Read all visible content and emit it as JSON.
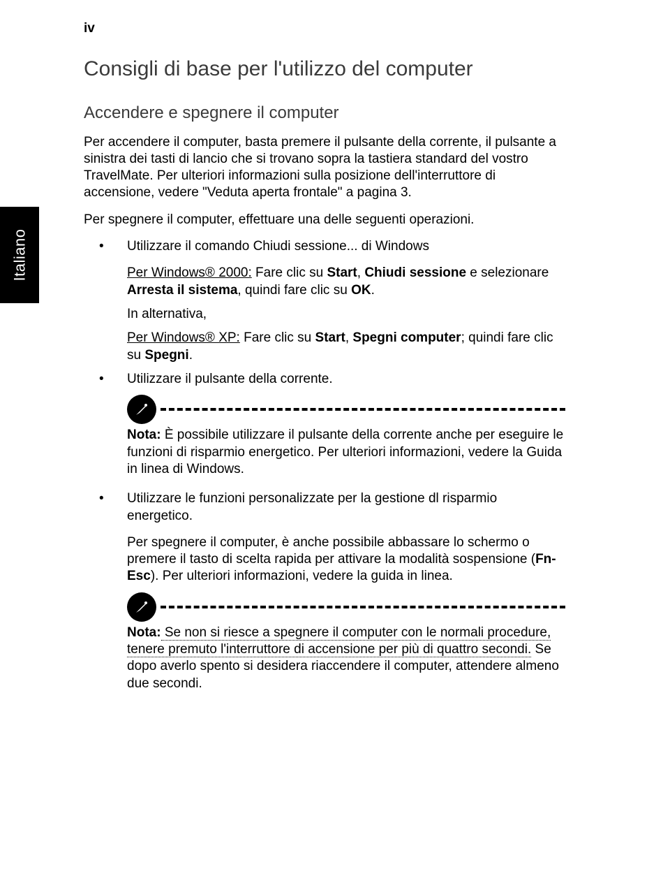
{
  "page_number": "iv",
  "sidebar_language": "Italiano",
  "title": "Consigli di base per l'utilizzo del computer",
  "subtitle": "Accendere e spegnere il computer",
  "intro_paragraph": "Per accendere il computer, basta premere il pulsante della corrente, il pulsante a sinistra dei tasti di lancio che si trovano sopra la tastiera standard del vostro TravelMate. Per ulteriori informazioni sulla posizione dell'interruttore di accensione, vedere \"Veduta aperta frontale\" a pagina 3.",
  "shutdown_intro": "Per spegnere il computer, effettuare una delle seguenti operazioni.",
  "bullet1_lead": "Utilizzare il comando Chiudi sessione... di Windows",
  "bullet1_win2000_prefix": "Per Windows® 2000:",
  "bullet1_win2000_body_1": " Fare clic su ",
  "bullet1_win2000_strong1": "Start",
  "bullet1_win2000_body_2": ", ",
  "bullet1_win2000_strong2": "Chiudi sessione",
  "bullet1_win2000_body_3": " e selezionare ",
  "bullet1_win2000_strong3": "Arresta il sistema",
  "bullet1_win2000_body_4": ", quindi fare clic su ",
  "bullet1_win2000_strong4": "OK",
  "bullet1_win2000_body_5": ".",
  "bullet1_alt": "In alternativa,",
  "bullet1_winxp_prefix": "Per Windows® XP:",
  "bullet1_winxp_body_1": " Fare clic su ",
  "bullet1_winxp_strong1": "Start",
  "bullet1_winxp_body_2": ", ",
  "bullet1_winxp_strong2": "Spegni computer",
  "bullet1_winxp_body_3": "; quindi fare clic su ",
  "bullet1_winxp_strong3": "Spegni",
  "bullet1_winxp_body_4": ".",
  "bullet2": "Utilizzare il pulsante della corrente.",
  "note1_label": "Nota:",
  "note1_text": " È possibile utilizzare il pulsante della corrente anche per eseguire le funzioni di risparmio energetico. Per ulteriori informazioni, vedere la Guida in linea di Windows.",
  "bullet3": "Utilizzare le funzioni personalizzate per la gestione dl risparmio energetico.",
  "bullet3_sub_1": "Per spegnere il computer, è anche possibile abbassare lo schermo o premere il tasto di scelta rapida per attivare la modalità sospensione (",
  "bullet3_sub_strong": "Fn-Esc",
  "bullet3_sub_2": "). Per ulteriori informazioni, vedere la guida in linea.",
  "note2_label": "Nota:",
  "note2_text_dotted": " Se non si riesce a spegnere il computer con le normali procedure, tenere premuto l'interruttore di accensione per più di quattro secondi.",
  "note2_text_plain": " Se dopo averlo spento si desidera riaccendere il computer, attendere almeno due secondi."
}
